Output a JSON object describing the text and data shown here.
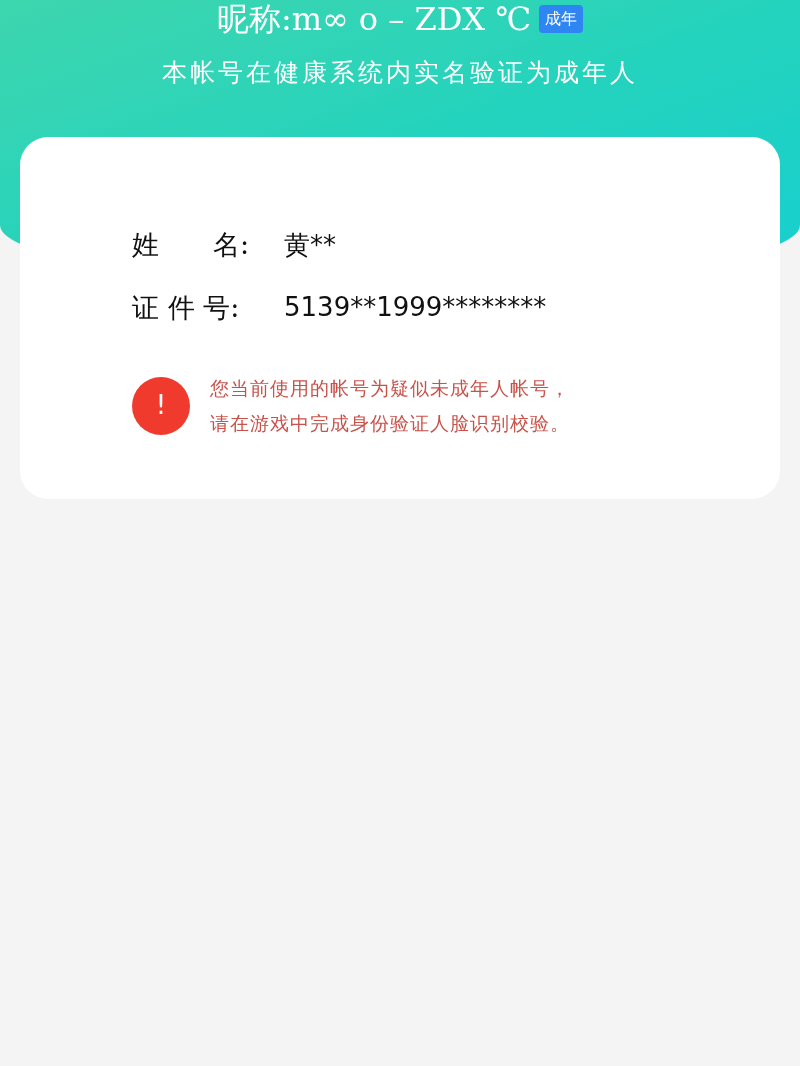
{
  "header": {
    "nickname": "昵称:m∞ o – ZDX ℃",
    "badge": "成年",
    "subtitle": "本帐号在健康系统内实名验证为成年人"
  },
  "fields": [
    {
      "label": "姓　　名:",
      "value": "黄**"
    },
    {
      "label": "证 件 号:",
      "value": "5139**1999********"
    }
  ],
  "warning": {
    "icon": "!",
    "lines": [
      "您当前使用的帐号为疑似未成年人帐号，",
      "请在游戏中完成身份验证人脸识别校验。"
    ]
  }
}
